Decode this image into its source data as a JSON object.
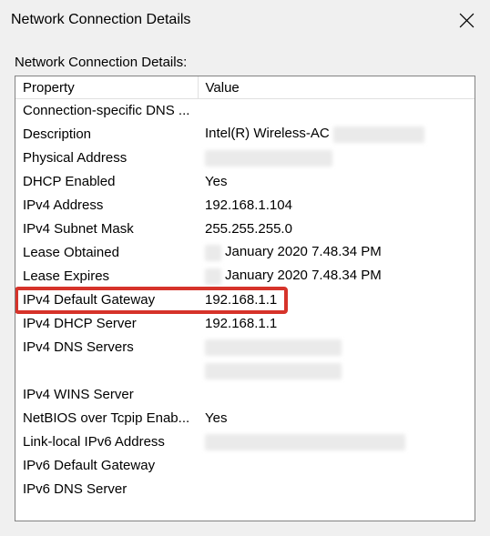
{
  "window": {
    "title": "Network Connection Details"
  },
  "content": {
    "subtitle": "Network Connection Details:",
    "columns": {
      "property": "Property",
      "value": "Value"
    },
    "rows": [
      {
        "property": "Connection-specific DNS ...",
        "value": ""
      },
      {
        "property": "Description",
        "value": "Intel(R) Wireless-AC",
        "redacted_after": 100
      },
      {
        "property": "Physical Address",
        "value": "",
        "redacted_only": 140
      },
      {
        "property": "DHCP Enabled",
        "value": "Yes"
      },
      {
        "property": "IPv4 Address",
        "value": "192.168.1.104"
      },
      {
        "property": "IPv4 Subnet Mask",
        "value": "255.255.255.0"
      },
      {
        "property": "Lease Obtained",
        "value": "January 2020 7.48.34 PM",
        "redacted_before": 18
      },
      {
        "property": "Lease Expires",
        "value": "January 2020 7.48.34 PM",
        "redacted_before": 18
      },
      {
        "property": "IPv4 Default Gateway",
        "value": "192.168.1.1",
        "highlight": true
      },
      {
        "property": "IPv4 DHCP Server",
        "value": "192.168.1.1"
      },
      {
        "property": "IPv4 DNS Servers",
        "value": "",
        "redacted_only": 150
      },
      {
        "property": "",
        "value": "",
        "redacted_only": 150
      },
      {
        "property": "IPv4 WINS Server",
        "value": ""
      },
      {
        "property": "NetBIOS over Tcpip Enab...",
        "value": "Yes"
      },
      {
        "property": "Link-local IPv6 Address",
        "value": "",
        "redacted_only": 220
      },
      {
        "property": "IPv6 Default Gateway",
        "value": ""
      },
      {
        "property": "IPv6 DNS Server",
        "value": ""
      }
    ]
  }
}
